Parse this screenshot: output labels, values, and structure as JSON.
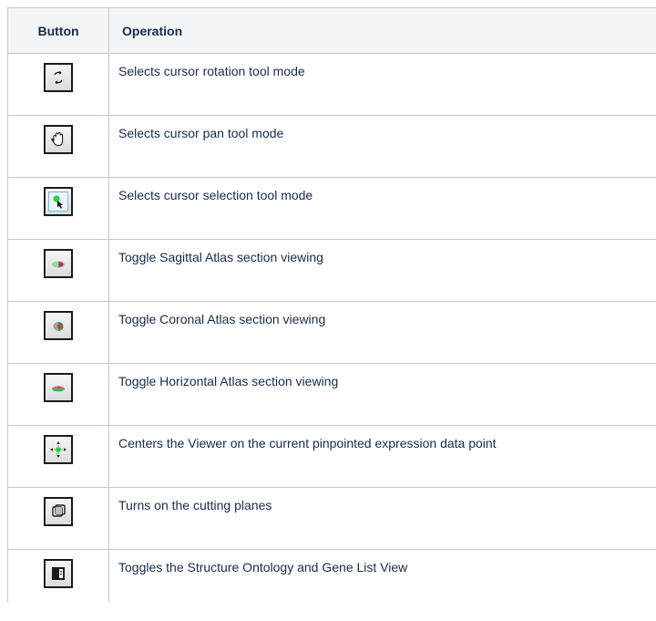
{
  "table": {
    "headers": {
      "button": "Button",
      "operation": "Operation"
    },
    "rows": [
      {
        "icon": "rotate-icon",
        "operation": "Selects cursor rotation tool mode"
      },
      {
        "icon": "hand-pan-icon",
        "operation": "Selects cursor pan tool mode"
      },
      {
        "icon": "selection-cursor-icon",
        "operation": "Selects cursor selection tool mode"
      },
      {
        "icon": "sagittal-atlas-icon",
        "operation": "Toggle Sagittal Atlas section viewing"
      },
      {
        "icon": "coronal-atlas-icon",
        "operation": "Toggle Coronal Atlas section viewing"
      },
      {
        "icon": "horizontal-atlas-icon",
        "operation": "Toggle Horizontal Atlas section viewing"
      },
      {
        "icon": "center-target-icon",
        "operation": "Centers the Viewer on the current pinpointed expression data point"
      },
      {
        "icon": "cutting-planes-icon",
        "operation": "Turns on the cutting planes"
      },
      {
        "icon": "ontology-panel-icon",
        "operation": "Toggles the Structure Ontology and Gene List View"
      }
    ]
  }
}
